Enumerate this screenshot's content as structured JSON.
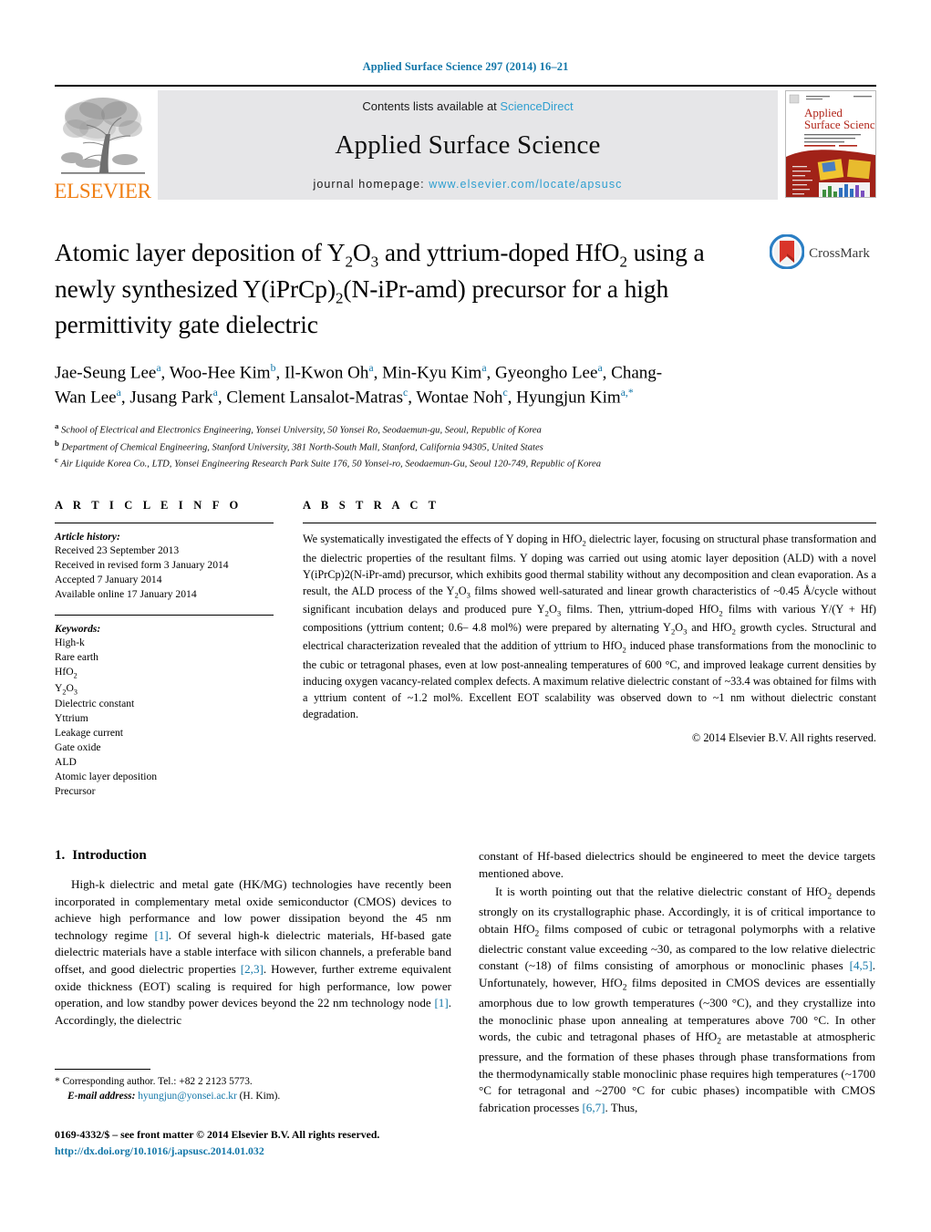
{
  "running_head": "Applied Surface Science 297 (2014) 16–21",
  "masthead": {
    "contents_prefix": "Contents lists available at ",
    "sciencedirect": "ScienceDirect",
    "journal_name": "Applied Surface Science",
    "homepage_prefix": "journal homepage: ",
    "homepage_url": "www.elsevier.com/locate/apsusc",
    "elsevier_wordmark": "ELSEVIER",
    "cover_title_line1": "Applied",
    "cover_title_line2": "Surface Science",
    "link_color": "#2f9fd0",
    "elsevier_orange": "#f07f13"
  },
  "article": {
    "title_line1_a": "Atomic layer deposition of Y",
    "title_sub1": "2",
    "title_line1_b": "O",
    "title_sub2": "3",
    "title_line1_c": " and yttrium-doped HfO",
    "title_sub3": "2",
    "title_line1_d": " using a",
    "title_line2_a": "newly synthesized Y(iPrCp)",
    "title_sub4": "2",
    "title_line2_b": "(N-iPr-amd) precursor for a high",
    "title_line3": "permittivity gate dielectric",
    "crossmark_label": "CrossMark"
  },
  "authors": [
    {
      "name": "Jae-Seung Lee",
      "sup": "a",
      "sep": ", "
    },
    {
      "name": "Woo-Hee Kim",
      "sup": "b",
      "sep": ", "
    },
    {
      "name": "Il-Kwon Oh",
      "sup": "a",
      "sep": ", "
    },
    {
      "name": "Min-Kyu Kim",
      "sup": "a",
      "sep": ", "
    },
    {
      "name": "Gyeongho Lee",
      "sup": "a",
      "sep": ", "
    },
    {
      "name": "Chang-Wan Lee",
      "sup": "a",
      "sep": ", "
    },
    {
      "name": "Jusang Park",
      "sup": "a",
      "sep": ", "
    },
    {
      "name": "Clement Lansalot-Matras",
      "sup": "c",
      "sep": ", "
    },
    {
      "name": "Wontae Noh",
      "sup": "c",
      "sep": ", "
    },
    {
      "name": "Hyungjun Kim",
      "sup": "a,*",
      "sep": ""
    }
  ],
  "affiliations": [
    {
      "marker": "a",
      "text": "School of Electrical and Electronics Engineering, Yonsei University, 50 Yonsei Ro, Seodaemun-gu, Seoul, Republic of Korea"
    },
    {
      "marker": "b",
      "text": "Department of Chemical Engineering, Stanford University, 381 North-South Mall, Stanford, California 94305, United States"
    },
    {
      "marker": "c",
      "text": "Air Liquide Korea Co., LTD, Yonsei Engineering Research Park Suite 176, 50 Yonsei-ro, Seodaemun-Gu, Seoul 120-749, Republic of Korea"
    }
  ],
  "article_info": {
    "heading": "A R T I C L E    I N F O",
    "history_label": "Article history:",
    "history": [
      "Received 23 September 2013",
      "Received in revised form 3 January 2014",
      "Accepted 7 January 2014",
      "Available online 17 January 2014"
    ],
    "keywords_label": "Keywords:",
    "keywords": [
      "High-k",
      "Rare earth",
      "HfO2",
      "Y2O3",
      "Dielectric constant",
      "Yttrium",
      "Leakage current",
      "Gate oxide",
      "ALD",
      "Atomic layer deposition",
      "Precursor"
    ]
  },
  "abstract": {
    "heading": "A B S T R A C T",
    "text": "We systematically investigated the effects of Y doping in HfO2 dielectric layer, focusing on structural phase transformation and the dielectric properties of the resultant films. Y doping was carried out using atomic layer deposition (ALD) with a novel Y(iPrCp)2(N-iPr-amd) precursor, which exhibits good thermal stability without any decomposition and clean evaporation. As a result, the ALD process of the Y2O3 films showed well-saturated and linear growth characteristics of ~0.45 Å/cycle without significant incubation delays and produced pure Y2O3 films. Then, yttrium-doped HfO2 films with various Y/(Y + Hf) compositions (yttrium content; 0.6– 4.8 mol%) were prepared by alternating Y2O3 and HfO2 growth cycles. Structural and electrical characterization revealed that the addition of yttrium to HfO2 induced phase transformations from the monoclinic to the cubic or tetragonal phases, even at low post-annealing temperatures of 600 °C, and improved leakage current densities by inducing oxygen vacancy-related complex defects. A maximum relative dielectric constant of ~33.4 was obtained for films with a yttrium content of ~1.2 mol%. Excellent EOT scalability was observed down to ~1 nm without dielectric constant degradation.",
    "copyright": "© 2014 Elsevier B.V. All rights reserved."
  },
  "introduction": {
    "number": "1.",
    "heading": "Introduction",
    "para1": "High-k dielectric and metal gate (HK/MG) technologies have recently been incorporated in complementary metal oxide semiconductor (CMOS) devices to achieve high performance and low power dissipation beyond the 45 nm technology regime [1]. Of several high-k dielectric materials, Hf-based gate dielectric materials have a stable interface with silicon channels, a preferable band offset, and good dielectric properties [2,3]. However, further extreme equivalent oxide thickness (EOT) scaling is required for high performance, low power operation, and low standby power devices beyond the 22 nm technology node [1]. Accordingly, the dielectric constant of Hf-based dielectrics should be engineered to meet the device targets mentioned above.",
    "para2": "It is worth pointing out that the relative dielectric constant of HfO2 depends strongly on its crystallographic phase. Accordingly, it is of critical importance to obtain HfO2 films composed of cubic or tetragonal polymorphs with a relative dielectric constant value exceeding ~30, as compared to the low relative dielectric constant (~18) of films consisting of amorphous or monoclinic phases [4,5]. Unfortunately, however, HfO2 films deposited in CMOS devices are essentially amorphous due to low growth temperatures (~300 °C), and they crystallize into the monoclinic phase upon annealing at temperatures above 700 °C. In other words, the cubic and tetragonal phases of HfO2 are metastable at atmospheric pressure, and the formation of these phases through phase transformations from the thermodynamically stable monoclinic phase requires high temperatures (~1700 °C for tetragonal and ~2700 °C for cubic phases) incompatible with CMOS fabrication processes [6,7]. Thus,"
  },
  "footer": {
    "corresponding_marker": "*",
    "corresponding_text": "Corresponding author. Tel.: +82 2 2123 5773.",
    "email_label": "E-mail address:",
    "email": "hyungjun@yonsei.ac.kr",
    "email_suffix": "(H. Kim).",
    "issn_line": "0169-4332/$ – see front matter © 2014 Elsevier B.V. All rights reserved.",
    "doi": "http://dx.doi.org/10.1016/j.apsusc.2014.01.032"
  }
}
